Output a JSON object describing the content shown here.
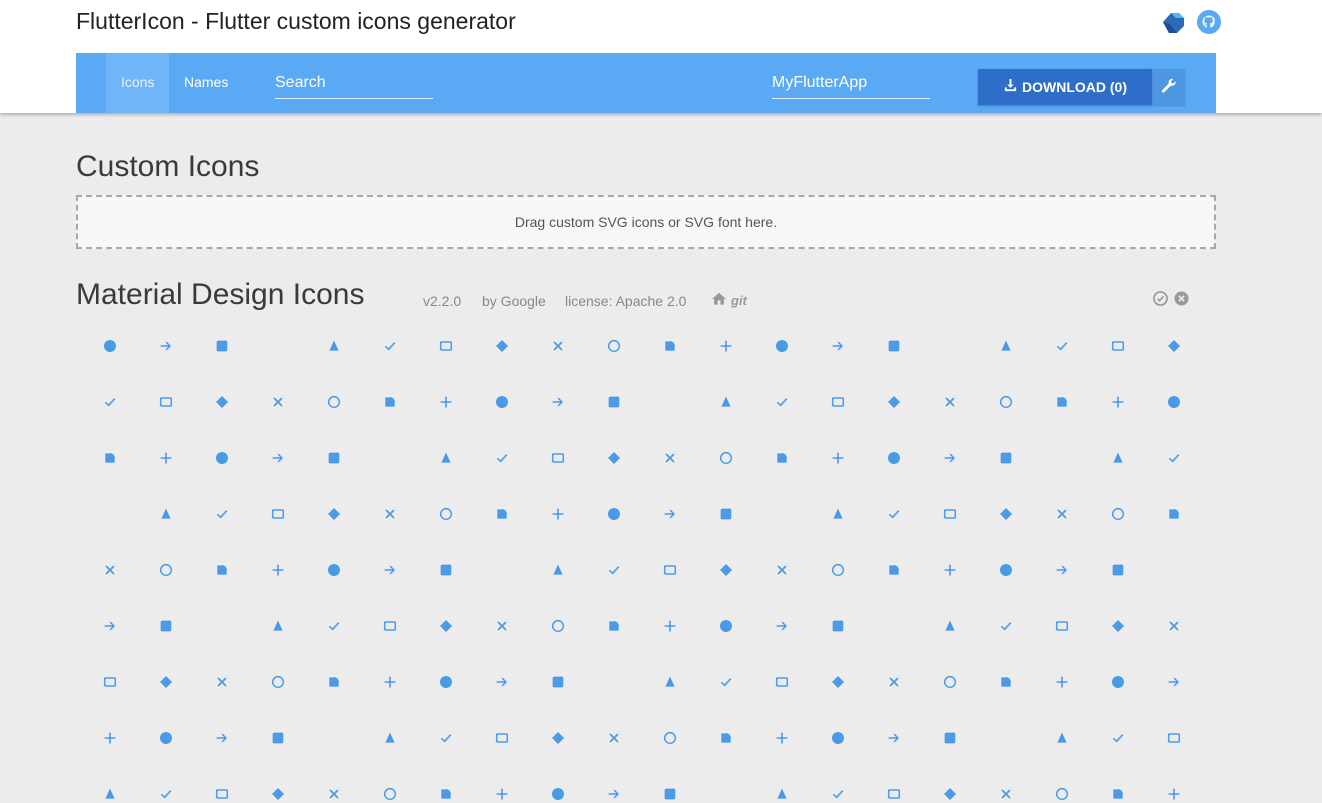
{
  "app": {
    "title": "FlutterIcon - Flutter custom icons generator",
    "header_icons": [
      "dart-logo-icon",
      "github-icon"
    ]
  },
  "nav": {
    "tabs": [
      {
        "label": "Icons",
        "active": true
      },
      {
        "label": "Names",
        "active": false
      }
    ],
    "search_placeholder": "Search",
    "app_name_value": "MyFlutterApp",
    "download_label": "DOWNLOAD (0)",
    "download_icon": "download-icon",
    "settings_icon": "wrench-icon"
  },
  "custom": {
    "title": "Custom Icons",
    "dropzone_text": "Drag custom SVG icons or SVG font here."
  },
  "material": {
    "title": "Material Design Icons",
    "version": "v2.2.0",
    "author": "by Google",
    "license": "license: Apache 2.0",
    "git_label": "git",
    "links": [
      "home-icon",
      "git-icon"
    ],
    "actions": [
      "select-all-icon",
      "deselect-all-icon"
    ]
  },
  "colors": {
    "accent": "#59a9f5",
    "icon": "#4a9ae8",
    "download": "#2f6ec8",
    "page_bg": "#ececec"
  },
  "icons": [
    "3d-rotation",
    "ac-unit",
    "access-alarm",
    "access-alarms",
    "access-time",
    "accessibility",
    "accessible",
    "account-balance",
    "account-balance-wallet",
    "account-box",
    "account-circle",
    "adb",
    "add",
    "add-a-photo",
    "add-alarm",
    "add-alert",
    "add-box",
    "add-circle",
    "add-circle-outline",
    "add-location",
    "add-shopping-cart",
    "add-to-photos",
    "add-to-queue",
    "adjust",
    "airline-seat-flat",
    "airline-seat-flat-angled",
    "airline-seat-individual-suite",
    "airline-seat-legroom-extra",
    "airline-seat-legroom-normal",
    "airline-seat-legroom-reduced",
    "airline-seat-recline-extra",
    "airline-seat-recline-normal",
    "airplanemode-active",
    "airplanemode-inactive",
    "airplay",
    "airport-shuttle",
    "alarm",
    "alarm-add",
    "alarm-off",
    "alarm-on",
    "album",
    "all-inclusive",
    "all-out",
    "android",
    "announcement",
    "apps",
    "archive",
    "arrow-back",
    "arrow-downward",
    "arrow-drop-down",
    "arrow-drop-down-circle",
    "arrow-drop-up",
    "arrow-forward",
    "arrow-upward",
    "art-track",
    "aspect-ratio",
    "assessment",
    "assignment",
    "assignment-ind",
    "assignment-late",
    "assignment-return",
    "assignment-returned",
    "assignment-turned-in",
    "assistant",
    "assistant-photo",
    "attach-file",
    "attach-money",
    "attachment",
    "audiotrack",
    "autorenew",
    "av-timer",
    "backspace",
    "backup",
    "battery-alert",
    "battery-charging-full",
    "battery-full",
    "battery-std",
    "battery-unknown",
    "beach-access",
    "beenhere",
    "block",
    "bluetooth",
    "bluetooth-audio",
    "bluetooth-connected",
    "bluetooth-disabled",
    "bluetooth-searching",
    "blur-circular",
    "blur-linear",
    "blur-off",
    "blur-on",
    "book",
    "bookmark",
    "bookmark-border",
    "border-all",
    "border-bottom",
    "border-clear",
    "border-color",
    "border-horizontal",
    "border-inner",
    "border-left",
    "border-outer",
    "border-right",
    "border-style",
    "border-top",
    "border-vertical",
    "branding-watermark",
    "brightness-1",
    "brightness-2",
    "brightness-3",
    "brightness-4",
    "brightness-5",
    "brightness-6",
    "brightness-7",
    "brightness-auto",
    "brightness-high",
    "brightness-low",
    "brightness-medium",
    "broken-image",
    "brush",
    "bubble-chart",
    "bug-report",
    "build",
    "burst-mode",
    "business",
    "business-center",
    "cached",
    "cake",
    "call",
    "call-end",
    "call-made",
    "call-merge",
    "call-missed",
    "call-missed-outgoing",
    "call-received",
    "call-split",
    "call-to-action",
    "camera",
    "camera-alt",
    "camera-enhance",
    "camera-front",
    "camera-rear",
    "camera-roll",
    "cancel",
    "card-giftcard",
    "card-membership",
    "card-travel",
    "casino",
    "cast",
    "cast-connected",
    "center-focus-strong",
    "center-focus-weak",
    "change-history",
    "chat",
    "chat-bubble",
    "chat-bubble-outline",
    "check",
    "check-box",
    "check-box-outline-blank",
    "check-circle",
    "chevron-left",
    "chevron-right",
    "child-care",
    "child-friendly",
    "chrome-reader-mode",
    "class",
    "clear",
    "clear-all",
    "close",
    "closed-caption",
    "cloud",
    "cloud-circle",
    "cloud-done",
    "cloud-download",
    "cloud-off",
    "cloud-queue",
    "cloud-upload",
    "code",
    "collections",
    "collections-bookmark",
    "color-lens"
  ]
}
